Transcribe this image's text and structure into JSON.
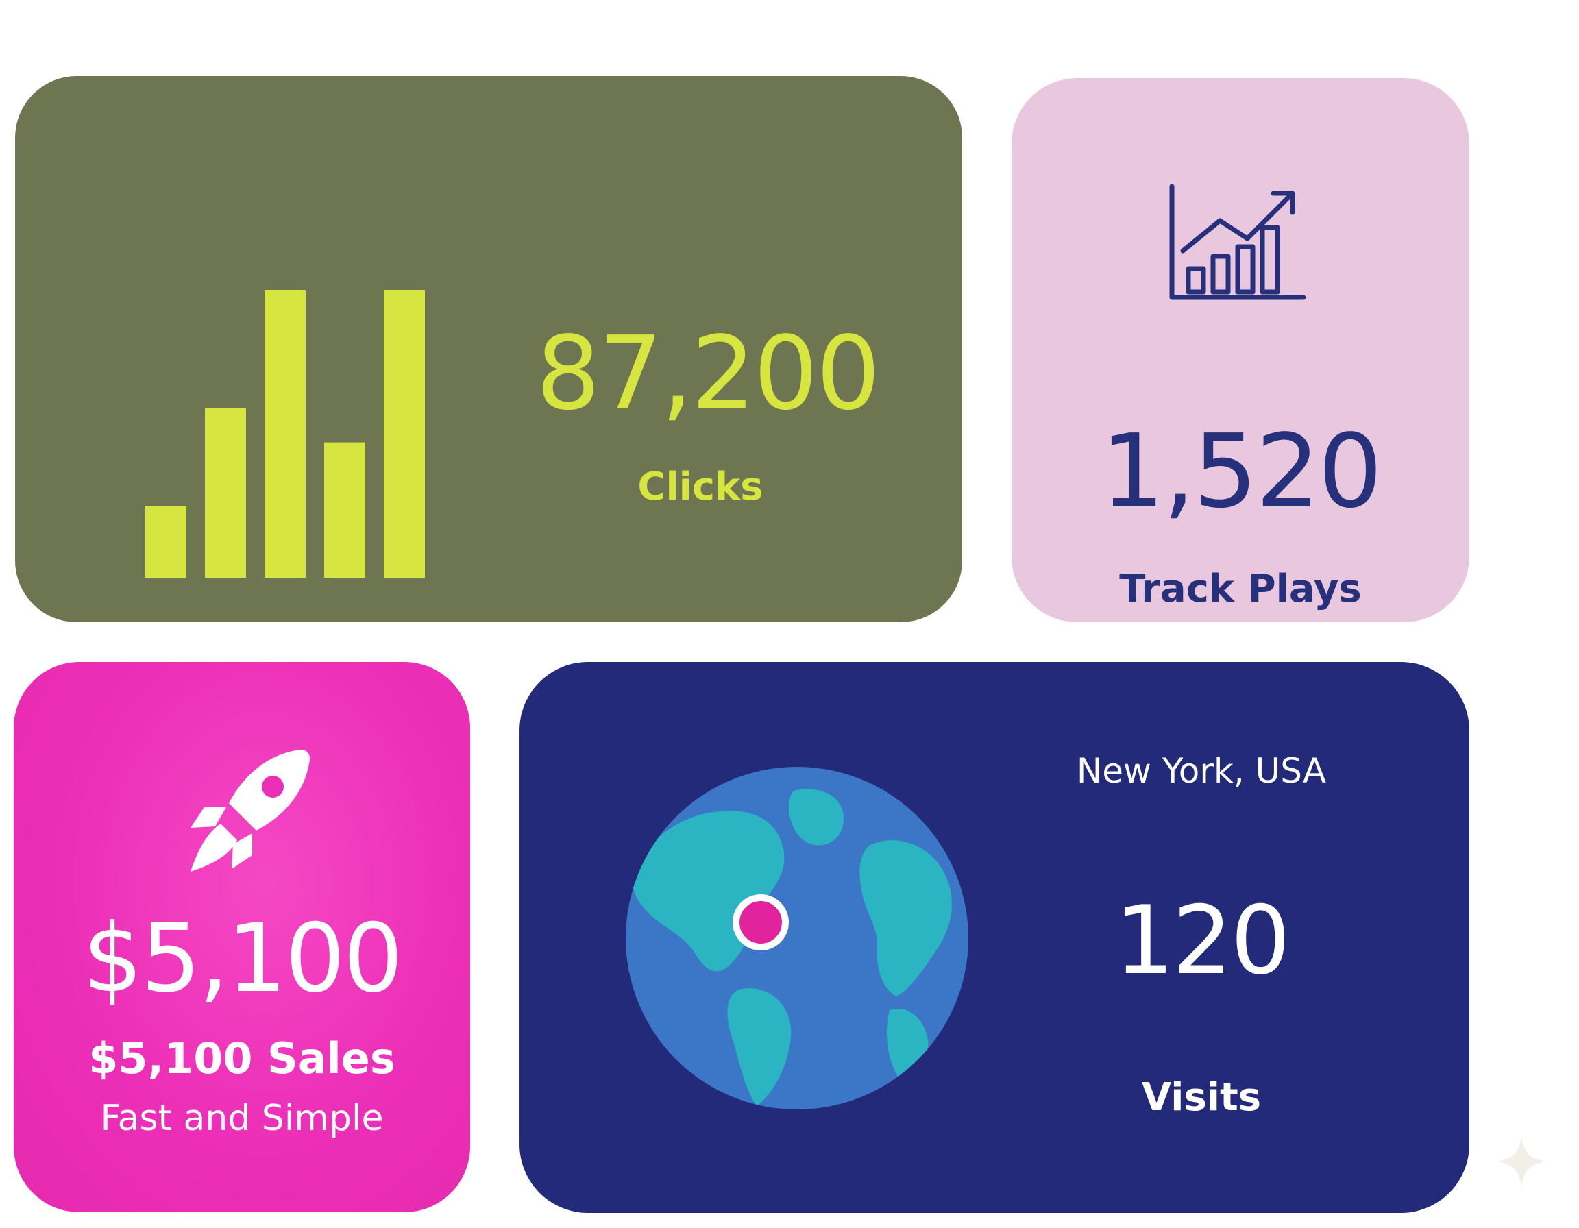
{
  "colors": {
    "clicks_bg": "#6e7551",
    "clicks_accent": "#d6e540",
    "plays_bg": "#e8c7df",
    "plays_accent": "#27307a",
    "sales_bg": "#ec2fb7",
    "visits_bg": "#222a79",
    "globe_ocean": "#3c76c6",
    "globe_land": "#2bb4c2",
    "marker": "#e1249e"
  },
  "clicks": {
    "value": "87,200",
    "label": "Clicks",
    "icon": "bar-chart-icon",
    "bars": [
      0.25,
      0.59,
      1.0,
      0.47,
      1.0
    ]
  },
  "plays": {
    "value": "1,520",
    "label": "Track Plays",
    "icon": "trending-chart-icon"
  },
  "sales": {
    "value": "$5,100",
    "title": "$5,100 Sales",
    "subtitle": "Fast and Simple",
    "icon": "rocket-icon"
  },
  "visits": {
    "location": "New York, USA",
    "value": "120",
    "label": "Visits",
    "icon": "globe-icon"
  }
}
